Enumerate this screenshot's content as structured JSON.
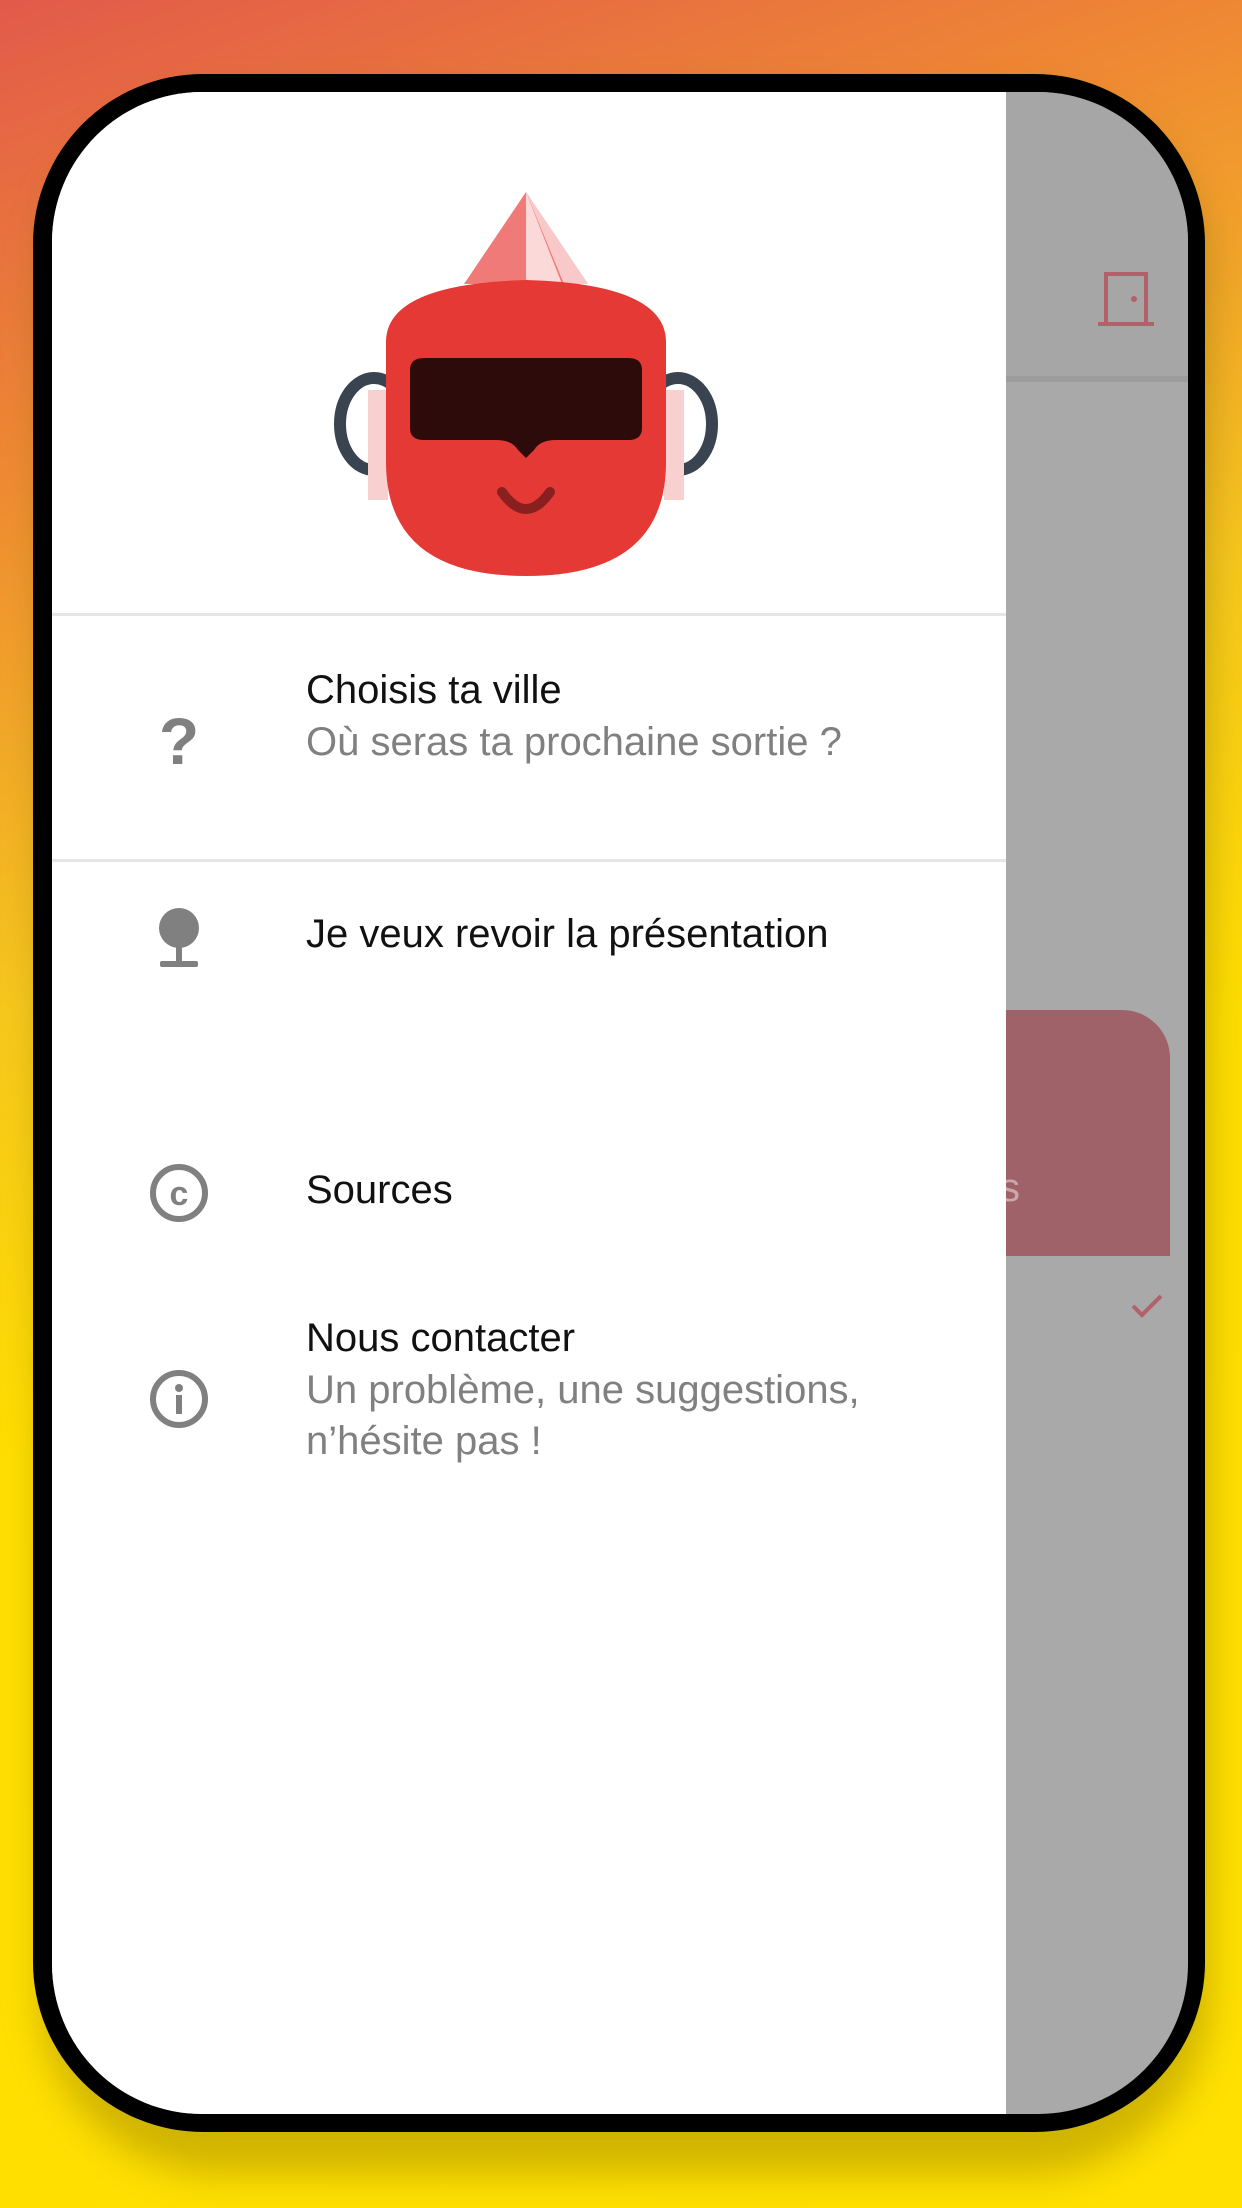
{
  "colors": {
    "background_top": "#e25a4a",
    "background_bottom": "#ffe000",
    "drawer_background": "#ffffff",
    "scrim": "#a9a9a9",
    "accent": "#e53935",
    "icon_gray": "#808080"
  },
  "header": {
    "logo_icon": "vr-mascot-logo"
  },
  "menu": {
    "items": [
      {
        "icon": "question-mark-icon",
        "title": "Choisis ta ville",
        "subtitle": "Où seras ta prochaine sortie ?"
      },
      {
        "icon": "lightbulb-icon",
        "title": "Je veux revoir la présentation"
      },
      {
        "icon": "copyright-icon",
        "title": "Sources"
      },
      {
        "icon": "info-icon",
        "title": "Nous contacter",
        "subtitle": "Un problème, une suggestions, n’hésite pas !"
      }
    ]
  },
  "background_app": {
    "appbar_icon": "door-icon",
    "card_text_fragment": "s",
    "card_icon": "check-icon"
  }
}
